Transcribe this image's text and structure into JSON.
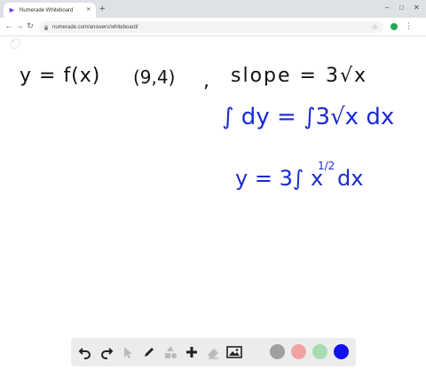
{
  "browser": {
    "tab_title": "Numerade Whiteboard",
    "url": "numerade.com/answers/whiteboard/",
    "new_tab": "+",
    "tab_close": "×"
  },
  "whiteboard": {
    "handwriting": {
      "line1_left": "y = f(x)",
      "line1_point": "(9,4)",
      "line1_comma": ",",
      "line1_slope": "slope = 3√x",
      "line2": "∫ dy = ∫3√x dx",
      "line3_y": "y = 3∫ x",
      "line3_exp": "1/2",
      "line3_dx": "dx"
    }
  },
  "toolbar": {
    "tools": [
      "undo-icon",
      "redo-icon",
      "pointer-icon",
      "pen-icon",
      "shapes-icon",
      "add-icon",
      "eraser-icon",
      "image-icon"
    ],
    "colors": [
      "#a0a0a0",
      "#f1a3a3",
      "#a8dcb0",
      "#1111ee"
    ]
  }
}
